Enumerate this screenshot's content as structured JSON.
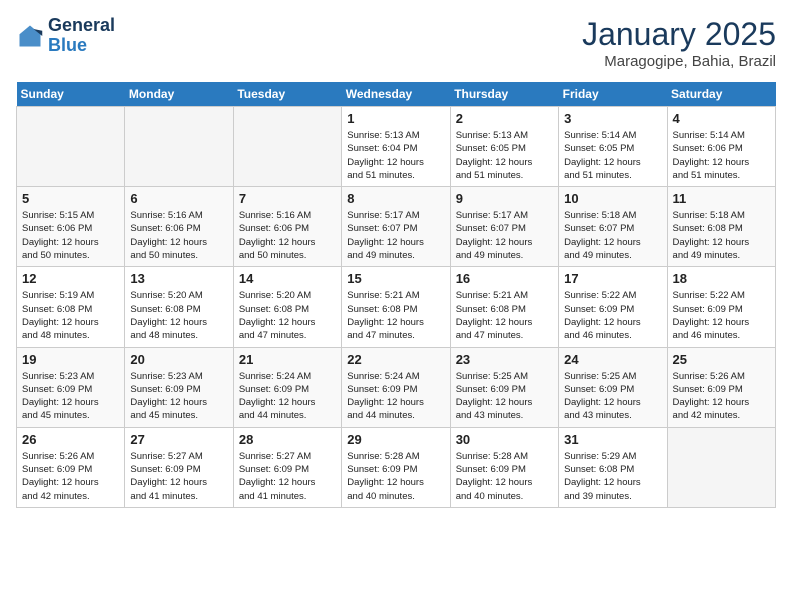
{
  "header": {
    "logo_line1": "General",
    "logo_line2": "Blue",
    "month_title": "January 2025",
    "location": "Maragogipe, Bahia, Brazil"
  },
  "weekdays": [
    "Sunday",
    "Monday",
    "Tuesday",
    "Wednesday",
    "Thursday",
    "Friday",
    "Saturday"
  ],
  "weeks": [
    [
      {
        "day": "",
        "info": ""
      },
      {
        "day": "",
        "info": ""
      },
      {
        "day": "",
        "info": ""
      },
      {
        "day": "1",
        "info": "Sunrise: 5:13 AM\nSunset: 6:04 PM\nDaylight: 12 hours\nand 51 minutes."
      },
      {
        "day": "2",
        "info": "Sunrise: 5:13 AM\nSunset: 6:05 PM\nDaylight: 12 hours\nand 51 minutes."
      },
      {
        "day": "3",
        "info": "Sunrise: 5:14 AM\nSunset: 6:05 PM\nDaylight: 12 hours\nand 51 minutes."
      },
      {
        "day": "4",
        "info": "Sunrise: 5:14 AM\nSunset: 6:06 PM\nDaylight: 12 hours\nand 51 minutes."
      }
    ],
    [
      {
        "day": "5",
        "info": "Sunrise: 5:15 AM\nSunset: 6:06 PM\nDaylight: 12 hours\nand 50 minutes."
      },
      {
        "day": "6",
        "info": "Sunrise: 5:16 AM\nSunset: 6:06 PM\nDaylight: 12 hours\nand 50 minutes."
      },
      {
        "day": "7",
        "info": "Sunrise: 5:16 AM\nSunset: 6:06 PM\nDaylight: 12 hours\nand 50 minutes."
      },
      {
        "day": "8",
        "info": "Sunrise: 5:17 AM\nSunset: 6:07 PM\nDaylight: 12 hours\nand 49 minutes."
      },
      {
        "day": "9",
        "info": "Sunrise: 5:17 AM\nSunset: 6:07 PM\nDaylight: 12 hours\nand 49 minutes."
      },
      {
        "day": "10",
        "info": "Sunrise: 5:18 AM\nSunset: 6:07 PM\nDaylight: 12 hours\nand 49 minutes."
      },
      {
        "day": "11",
        "info": "Sunrise: 5:18 AM\nSunset: 6:08 PM\nDaylight: 12 hours\nand 49 minutes."
      }
    ],
    [
      {
        "day": "12",
        "info": "Sunrise: 5:19 AM\nSunset: 6:08 PM\nDaylight: 12 hours\nand 48 minutes."
      },
      {
        "day": "13",
        "info": "Sunrise: 5:20 AM\nSunset: 6:08 PM\nDaylight: 12 hours\nand 48 minutes."
      },
      {
        "day": "14",
        "info": "Sunrise: 5:20 AM\nSunset: 6:08 PM\nDaylight: 12 hours\nand 47 minutes."
      },
      {
        "day": "15",
        "info": "Sunrise: 5:21 AM\nSunset: 6:08 PM\nDaylight: 12 hours\nand 47 minutes."
      },
      {
        "day": "16",
        "info": "Sunrise: 5:21 AM\nSunset: 6:08 PM\nDaylight: 12 hours\nand 47 minutes."
      },
      {
        "day": "17",
        "info": "Sunrise: 5:22 AM\nSunset: 6:09 PM\nDaylight: 12 hours\nand 46 minutes."
      },
      {
        "day": "18",
        "info": "Sunrise: 5:22 AM\nSunset: 6:09 PM\nDaylight: 12 hours\nand 46 minutes."
      }
    ],
    [
      {
        "day": "19",
        "info": "Sunrise: 5:23 AM\nSunset: 6:09 PM\nDaylight: 12 hours\nand 45 minutes."
      },
      {
        "day": "20",
        "info": "Sunrise: 5:23 AM\nSunset: 6:09 PM\nDaylight: 12 hours\nand 45 minutes."
      },
      {
        "day": "21",
        "info": "Sunrise: 5:24 AM\nSunset: 6:09 PM\nDaylight: 12 hours\nand 44 minutes."
      },
      {
        "day": "22",
        "info": "Sunrise: 5:24 AM\nSunset: 6:09 PM\nDaylight: 12 hours\nand 44 minutes."
      },
      {
        "day": "23",
        "info": "Sunrise: 5:25 AM\nSunset: 6:09 PM\nDaylight: 12 hours\nand 43 minutes."
      },
      {
        "day": "24",
        "info": "Sunrise: 5:25 AM\nSunset: 6:09 PM\nDaylight: 12 hours\nand 43 minutes."
      },
      {
        "day": "25",
        "info": "Sunrise: 5:26 AM\nSunset: 6:09 PM\nDaylight: 12 hours\nand 42 minutes."
      }
    ],
    [
      {
        "day": "26",
        "info": "Sunrise: 5:26 AM\nSunset: 6:09 PM\nDaylight: 12 hours\nand 42 minutes."
      },
      {
        "day": "27",
        "info": "Sunrise: 5:27 AM\nSunset: 6:09 PM\nDaylight: 12 hours\nand 41 minutes."
      },
      {
        "day": "28",
        "info": "Sunrise: 5:27 AM\nSunset: 6:09 PM\nDaylight: 12 hours\nand 41 minutes."
      },
      {
        "day": "29",
        "info": "Sunrise: 5:28 AM\nSunset: 6:09 PM\nDaylight: 12 hours\nand 40 minutes."
      },
      {
        "day": "30",
        "info": "Sunrise: 5:28 AM\nSunset: 6:09 PM\nDaylight: 12 hours\nand 40 minutes."
      },
      {
        "day": "31",
        "info": "Sunrise: 5:29 AM\nSunset: 6:08 PM\nDaylight: 12 hours\nand 39 minutes."
      },
      {
        "day": "",
        "info": ""
      }
    ]
  ]
}
